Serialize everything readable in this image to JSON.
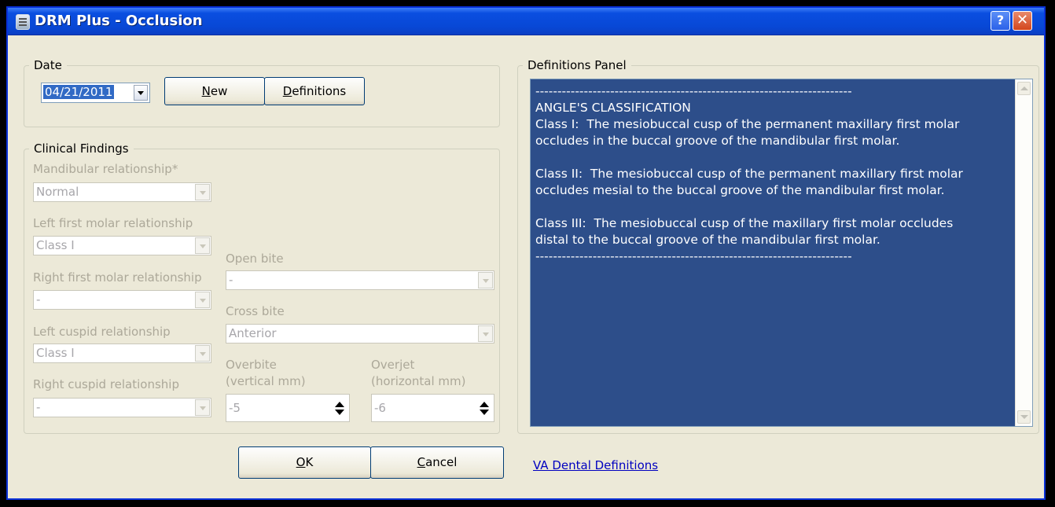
{
  "window": {
    "title": "DRM Plus - Occlusion",
    "help_label": "?",
    "close_label": "✕"
  },
  "date_group": {
    "legend": "Date",
    "date_value": "04/21/2011",
    "new_button": {
      "underline": "N",
      "rest": "ew"
    },
    "definitions_button": {
      "underline": "D",
      "rest": "efinitions"
    }
  },
  "clinical": {
    "legend": "Clinical Findings",
    "mandibular": {
      "label": "Mandibular relationship*",
      "value": "Normal"
    },
    "left_molar": {
      "label": "Left first molar relationship",
      "value": "Class I"
    },
    "right_molar": {
      "label": "Right first molar relationship",
      "value": "-"
    },
    "left_cuspid": {
      "label": "Left cuspid relationship",
      "value": "Class I"
    },
    "right_cuspid": {
      "label": "Right cuspid relationship",
      "value": "-"
    },
    "open_bite": {
      "label": "Open bite",
      "value": "-"
    },
    "cross_bite": {
      "label": "Cross bite",
      "value": "Anterior"
    },
    "overbite": {
      "label1": "Overbite",
      "label2": "(vertical mm)",
      "value": "-5"
    },
    "overjet": {
      "label1": "Overjet",
      "label2": "(horizontal mm)",
      "value": "-6"
    }
  },
  "definitions_panel": {
    "legend": "Definitions Panel",
    "text": "------------------------------------------------------------------------\nANGLE'S CLASSIFICATION\nClass I:  The mesiobuccal cusp of the permanent maxillary first molar\noccludes in the buccal groove of the mandibular first molar.\n\nClass II:  The mesiobuccal cusp of the permanent maxillary first molar\noccludes mesial to the buccal groove of the mandibular first molar.\n\nClass III:  The mesiobuccal cusp of the maxillary first molar occludes\ndistal to the buccal groove of the mandibular first molar.\n------------------------------------------------------------------------"
  },
  "footer": {
    "ok_button": {
      "underline": "O",
      "rest": "K"
    },
    "cancel_button": {
      "underline": "C",
      "rest": "ancel"
    },
    "link": "VA Dental Definitions"
  },
  "colors": {
    "panel_bg": "#2d4e8a",
    "titlebar": "#0a4ee0",
    "link": "#0000c0"
  }
}
